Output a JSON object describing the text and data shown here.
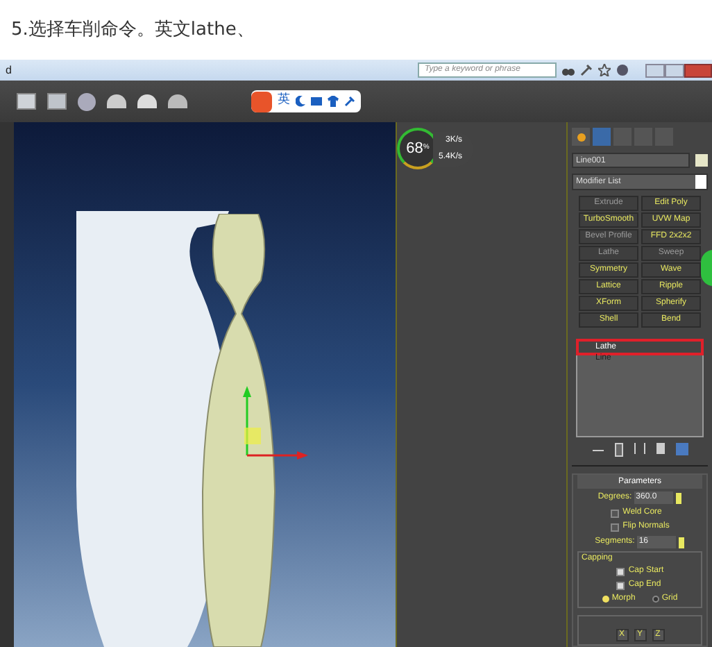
{
  "caption": "5.选择车削命令。英文lathe、",
  "window": {
    "title": "d",
    "search": {
      "placeholder": "Type a keyword or phrase"
    }
  },
  "ime_toolbar": {
    "mode": "英"
  },
  "viewport": {
    "stats": {
      "percent": "68",
      "percent_unit": "%",
      "upload": "3K/s",
      "download": "5.4K/s"
    }
  },
  "command_panel": {
    "object_name": "Line001",
    "modifier_list": "Modifier List",
    "modifiers": [
      {
        "label": "Extrude",
        "dimmed": true
      },
      {
        "label": "Edit Poly",
        "dimmed": false
      },
      {
        "label": "TurboSmooth",
        "dimmed": false
      },
      {
        "label": "UVW Map",
        "dimmed": false
      },
      {
        "label": "Bevel Profile",
        "dimmed": true
      },
      {
        "label": "FFD 2x2x2",
        "dimmed": false
      },
      {
        "label": "Lathe",
        "dimmed": true
      },
      {
        "label": "Sweep",
        "dimmed": true
      },
      {
        "label": "Symmetry",
        "dimmed": false
      },
      {
        "label": "Wave",
        "dimmed": false
      },
      {
        "label": "Lattice",
        "dimmed": false
      },
      {
        "label": "Ripple",
        "dimmed": false
      },
      {
        "label": "XForm",
        "dimmed": false
      },
      {
        "label": "Spherify",
        "dimmed": false
      },
      {
        "label": "Shell",
        "dimmed": false
      },
      {
        "label": "Bend",
        "dimmed": false
      }
    ],
    "stack": [
      {
        "label": "Lathe",
        "selected": true
      },
      {
        "label": "Line",
        "selected": false
      }
    ],
    "parameters": {
      "title": "Parameters",
      "degrees_label": "Degrees:",
      "degrees": "360.0",
      "checks": [
        {
          "label": "Weld Core",
          "checked": false
        },
        {
          "label": "Flip Normals",
          "checked": false
        }
      ],
      "segments_label": "Segments:",
      "segments": "16",
      "capping": {
        "title": "Capping",
        "checks": [
          {
            "label": "Cap Start",
            "checked": true
          },
          {
            "label": "Cap End",
            "checked": true
          }
        ],
        "radios": [
          {
            "label": "Morph",
            "selected": true
          },
          {
            "label": "Grid",
            "selected": false
          }
        ]
      },
      "axes": [
        "X",
        "Y",
        "Z"
      ]
    }
  }
}
